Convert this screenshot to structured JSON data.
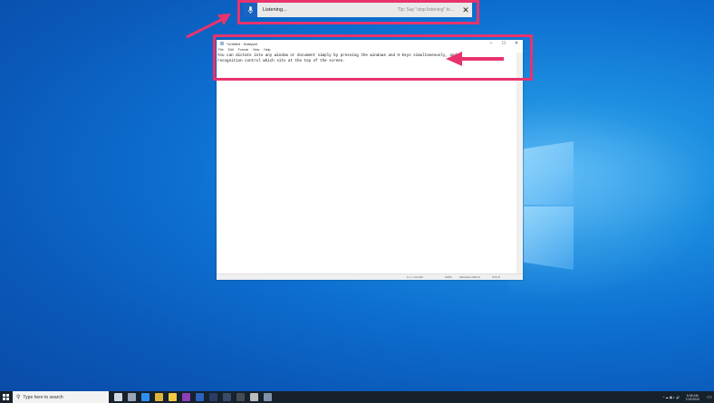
{
  "dictation": {
    "status": "Listening...",
    "tip": "Tip: Say \"stop listening\" to...",
    "close_symbol": "✕",
    "mic_color": "#1a64c4"
  },
  "notepad": {
    "title": "*Untitled - Notepad",
    "controls": [
      "–",
      "☐",
      "✕"
    ],
    "menu": [
      "File",
      "Edit",
      "Format",
      "View",
      "Help"
    ],
    "text": "You can dictate into any window or document simply by pressing the windows and H keys simultaneously, and a\nrecognition control which sits at the top of the screen.",
    "status": {
      "position": "Ln 1, Col 160",
      "zoom": "100%",
      "line_ending": "Windows (CRLF)",
      "encoding": "UTF-8"
    }
  },
  "highlight_color": "#e8336d",
  "taskbar": {
    "search_placeholder": "Type here to search",
    "clock_time": "5:08 AM",
    "clock_date": "7/19/2020",
    "apps": [
      {
        "name": "task-view-icon",
        "color": "#cfd8e3"
      },
      {
        "name": "multitask-icon",
        "color": "#9aa6b3"
      },
      {
        "name": "edge-icon",
        "color": "#2f8ff0"
      },
      {
        "name": "chrome-icon",
        "color": "#e0b43a"
      },
      {
        "name": "file-explorer-icon",
        "color": "#f2c744"
      },
      {
        "name": "onenote-icon",
        "color": "#8d3fb8"
      },
      {
        "name": "word-icon",
        "color": "#2b62bf"
      },
      {
        "name": "photoshop-icon",
        "color": "#2a3c66"
      },
      {
        "name": "lightroom-icon",
        "color": "#3a4c6a"
      },
      {
        "name": "terminal-icon",
        "color": "#444c56"
      },
      {
        "name": "app-icon",
        "color": "#bcbcbc"
      },
      {
        "name": "notepad-icon",
        "color": "#7f93a8"
      }
    ]
  }
}
